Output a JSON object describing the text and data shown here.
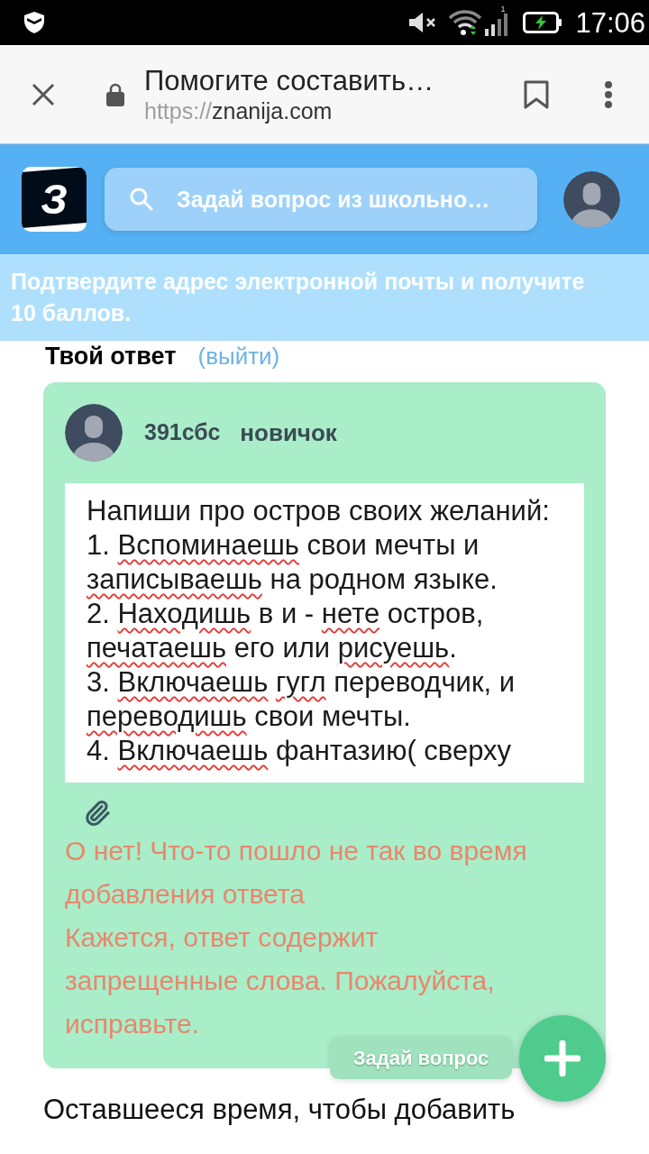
{
  "status_bar": {
    "sim_label": "1",
    "time": "17:06"
  },
  "browser_bar": {
    "title": "Помогите составить…",
    "url_scheme": "https://",
    "url_host": "znanija.com"
  },
  "header": {
    "logo": "З",
    "search": {
      "placeholder": "Задай вопрос из школьно…"
    }
  },
  "banner": {
    "text": "Подтвердите адрес электронной почты и получите 10 баллов."
  },
  "answer_section": {
    "title": "Твой ответ",
    "logout_link": "(выйти)"
  },
  "answer_card": {
    "author": {
      "name": "391сбс",
      "rank": "новичок"
    },
    "editor": {
      "lines": [
        {
          "segments": [
            {
              "text": "Напиши про остров своих желаний:",
              "misspelled": false
            }
          ]
        },
        {
          "segments": [
            {
              "text": "1. ",
              "misspelled": false
            },
            {
              "text": "Вспоминаешь",
              "misspelled": true
            },
            {
              "text": " свои мечты и",
              "misspelled": false
            }
          ]
        },
        {
          "segments": [
            {
              "text": "записываешь",
              "misspelled": true
            },
            {
              "text": " на родном языке.",
              "misspelled": false
            }
          ]
        },
        {
          "segments": [
            {
              "text": "2. ",
              "misspelled": false
            },
            {
              "text": "Находишь",
              "misspelled": true
            },
            {
              "text": " в и - ",
              "misspelled": false
            },
            {
              "text": "нете",
              "misspelled": true
            },
            {
              "text": " остров,",
              "misspelled": false
            }
          ]
        },
        {
          "segments": [
            {
              "text": "печатаешь",
              "misspelled": true
            },
            {
              "text": " его или ",
              "misspelled": false
            },
            {
              "text": "рисуешь",
              "misspelled": true
            },
            {
              "text": ".",
              "misspelled": false
            }
          ]
        },
        {
          "segments": [
            {
              "text": "3. ",
              "misspelled": false
            },
            {
              "text": "Включаешь ",
              "misspelled": true
            },
            {
              "text": "гугл",
              "misspelled": true
            },
            {
              "text": " переводчик, и",
              "misspelled": false
            }
          ]
        },
        {
          "segments": [
            {
              "text": "переводишь",
              "misspelled": true
            },
            {
              "text": " свои мечты.",
              "misspelled": false
            }
          ]
        },
        {
          "segments": [
            {
              "text": "4. ",
              "misspelled": false
            },
            {
              "text": "Включаешь",
              "misspelled": true
            },
            {
              "text": " фантазию( сверху",
              "misspelled": false
            }
          ]
        }
      ]
    },
    "errors": [
      "О нет! Что-то пошло не так во время добавления ответа",
      "Кажется, ответ содержит запрещенные слова. Пожалуйста, исправьте."
    ]
  },
  "floating": {
    "ask_button": "Задай вопрос"
  },
  "footer_text": "Оставшееся время, чтобы добавить"
}
